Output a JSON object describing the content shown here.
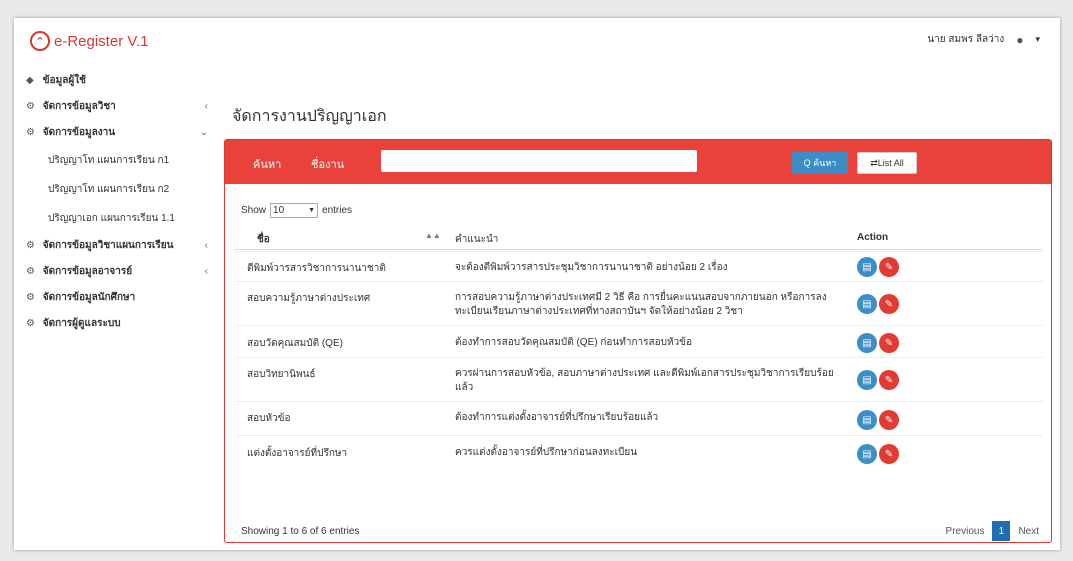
{
  "app": {
    "logo_glyph": "⌃",
    "name": "e-Register V.1"
  },
  "user": {
    "name": "นาย สมพร ลีลว่าง",
    "menu_glyph": "▾",
    "icon": "user-icon"
  },
  "sidebar": {
    "items": [
      {
        "label": "ข้อมูลผู้ใช้",
        "icon": "users-icon",
        "arrow": ""
      },
      {
        "label": "จัดการข้อมูลวิชา",
        "icon": "cogs-icon",
        "arrow": "‹"
      },
      {
        "label": "จัดการข้อมูลงาน",
        "icon": "cogs-icon",
        "arrow": "⌄"
      },
      {
        "label": "จัดการข้อมูลวิชาแผนการเรียน",
        "icon": "cogs-icon",
        "arrow": "‹"
      },
      {
        "label": "จัดการข้อมูลอาจารย์",
        "icon": "cogs-icon",
        "arrow": "‹"
      },
      {
        "label": "จัดการข้อมูลนักศึกษา",
        "icon": "cogs-icon",
        "arrow": ""
      },
      {
        "label": "จัดการผู้ดูแลระบบ",
        "icon": "cogs-icon",
        "arrow": ""
      }
    ],
    "subitems": [
      "ปริญญาโท แผนการเรียน ก1",
      "ปริญญาโท แผนการเรียน ก2",
      "ปริญญาเอก แผนการเรียน 1.1"
    ]
  },
  "page_title": "จัดการงานปริญญาเอก",
  "search_bar": {
    "search_label": "ค้นหา",
    "name_label": "ชื่องาน",
    "input_value": "",
    "search_button": "Q ค้นหา",
    "list_all_button": "⇄List All"
  },
  "length_control": {
    "prefix": "Show",
    "value": "10",
    "suffix": "entries"
  },
  "table": {
    "headers": {
      "name": "ชื่อ",
      "sort_glyph": "▲▲",
      "desc": "คำแนะนำ",
      "action": "Action"
    },
    "rows": [
      {
        "name": "ตีพิมพ์วารสารวิชาการนานาชาติ",
        "desc": "จะต้องตีพิมพ์วารสารประชุมวิชาการนานาชาติ อย่างน้อย 2 เรื่อง"
      },
      {
        "name": "สอบความรู้ภาษาต่างประเทศ",
        "desc": "การสอบความรู้ภาษาต่างประเทศมี 2 วิธี คือ การยื่นคะแนนสอบจากภายนอก หรือการลงทะเบียนเรียนภาษาต่างประเทศที่ทางสถาบันฯ จัดให้อย่างน้อย 2 วิชา"
      },
      {
        "name": "สอบวัดคุณสมบัติ (QE)",
        "desc": "ต้องทำการสอบวัดคุณสมบัติ (QE) ก่อนทำการสอบหัวข้อ"
      },
      {
        "name": "สอบวิทยานิพนธ์",
        "desc": "ควรผ่านการสอบหัวข้อ, สอบภาษาต่างประเทศ และตีพิมพ์เอกสารประชุมวิชาการเรียบร้อยแล้ว"
      },
      {
        "name": "สอบหัวข้อ",
        "desc": "ต้องทำการแต่งตั้งอาจารย์ที่ปรึกษาเรียบร้อยแล้ว"
      },
      {
        "name": "แต่งตั้งอาจารย์ที่ปรึกษา",
        "desc": "ควรแต่งตั้งอาจารย์ที่ปรึกษาก่อนลงทะเบียน"
      }
    ],
    "edit_glyph": "▤",
    "delete_glyph": "✎"
  },
  "footer": {
    "info": "Showing 1 to 6 of 6 entries",
    "previous": "Previous",
    "current_page": "1",
    "next": "Next"
  },
  "colors": {
    "accent": "#e8423b",
    "primary": "#3b8ec8",
    "page_active": "#1f6fb0"
  }
}
